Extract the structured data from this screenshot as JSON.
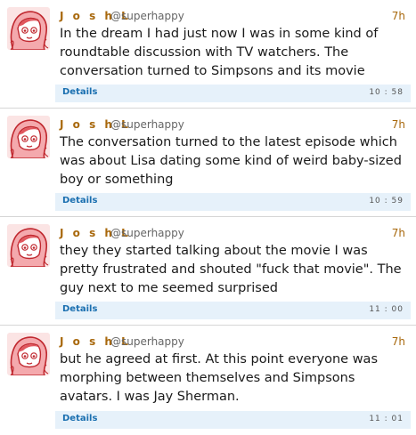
{
  "colors": {
    "name": "#a8680c",
    "handle": "#666666",
    "details_bg": "#e6f1fa",
    "details_link": "#1a6fb0"
  },
  "tweets": [
    {
      "name": "J o s h L",
      "handle": "@superhappy",
      "time": "7h",
      "text": "In the dream I had just now I was in some kind of roundtable discussion with TV watchers. The conversation turned to Simpsons and its movie",
      "details_label": "Details",
      "details_time": "10 : 58",
      "avatar_icon": "cartoon-girl-avatar-icon"
    },
    {
      "name": "J o s h L",
      "handle": "@superhappy",
      "time": "7h",
      "text": "The conversation turned to the latest episode which was about Lisa dating some kind of weird baby-sized boy or something",
      "details_label": "Details",
      "details_time": "10 : 59",
      "avatar_icon": "cartoon-girl-avatar-icon"
    },
    {
      "name": "J o s h L",
      "handle": "@superhappy",
      "time": "7h",
      "text": "they they started talking about the movie I was pretty frustrated and shouted \"fuck that movie\". The guy next to me seemed surprised",
      "details_label": "Details",
      "details_time": "11 : 00",
      "avatar_icon": "cartoon-girl-avatar-icon"
    },
    {
      "name": "J o s h L",
      "handle": "@superhappy",
      "time": "7h",
      "text": "but he agreed at first. At this point everyone was morphing between themselves and Simpsons avatars. I was Jay Sherman.",
      "details_label": "Details",
      "details_time": "11 : 01",
      "avatar_icon": "cartoon-girl-avatar-icon"
    }
  ]
}
